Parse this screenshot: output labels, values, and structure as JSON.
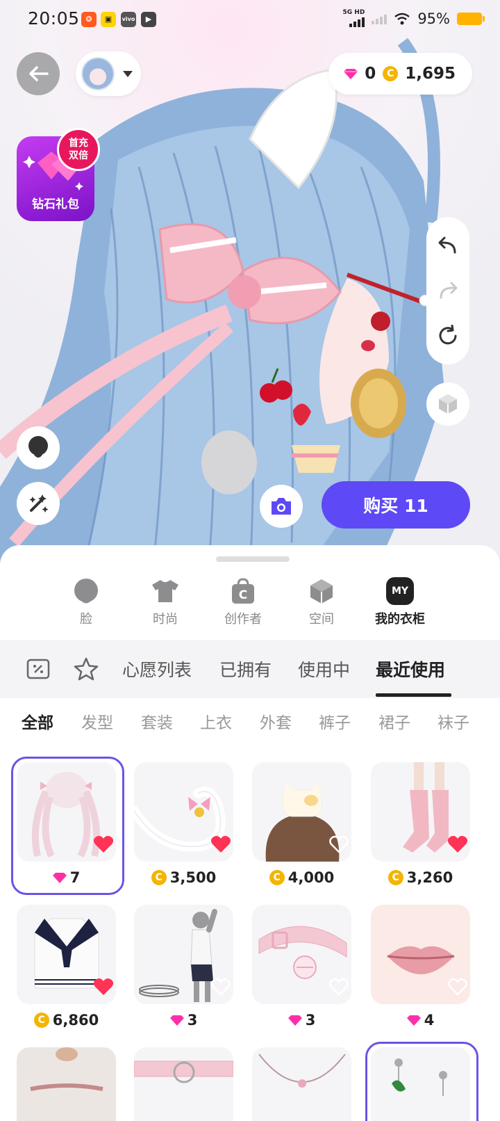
{
  "status_bar": {
    "time": "20:05",
    "network": "5G HD",
    "battery": "95%"
  },
  "top": {
    "diamonds": "0",
    "coins": "1,695"
  },
  "gift": {
    "label": "钻石礼包",
    "badge_line1": "首充",
    "badge_line2": "双倍"
  },
  "buy_button": "购买 11",
  "categories": [
    {
      "label": "脸",
      "icon": "face-icon"
    },
    {
      "label": "时尚",
      "icon": "tshirt-icon"
    },
    {
      "label": "创作者",
      "icon": "creator-bag-icon"
    },
    {
      "label": "空间",
      "icon": "cube-icon"
    },
    {
      "label": "我的衣柜",
      "icon": "my-wardrobe-icon",
      "badge": "MY"
    }
  ],
  "tabs": [
    "心愿列表",
    "已拥有",
    "使用中",
    "最近使用"
  ],
  "active_tab": "最近使用",
  "filters": [
    "全部",
    "发型",
    "套装",
    "上衣",
    "外套",
    "裤子",
    "裙子",
    "袜子"
  ],
  "active_filter": "全部",
  "items": [
    {
      "currency": "diamond",
      "price": "7",
      "liked": true,
      "thumb": "pink twin-tail hair"
    },
    {
      "currency": "coin",
      "price": "3,500",
      "liked": true,
      "thumb": "cat tail with bow"
    },
    {
      "currency": "coin",
      "price": "4,000",
      "liked": false,
      "thumb": "cat hat with bangs"
    },
    {
      "currency": "coin",
      "price": "3,260",
      "liked": true,
      "thumb": "pink leg warmers"
    },
    {
      "currency": "coin",
      "price": "6,860",
      "liked": true,
      "thumb": "sailor top"
    },
    {
      "currency": "diamond",
      "price": "3",
      "liked": false,
      "thumb": "bracelet"
    },
    {
      "currency": "diamond",
      "price": "3",
      "liked": false,
      "thumb": "pink bell collar"
    },
    {
      "currency": "diamond",
      "price": "4",
      "liked": false,
      "thumb": "pink lips"
    }
  ],
  "colors": {
    "accent": "#5d49f5",
    "heart": "#ff3355",
    "coin": "#f4b400",
    "diamond": "#ff2fa8"
  }
}
